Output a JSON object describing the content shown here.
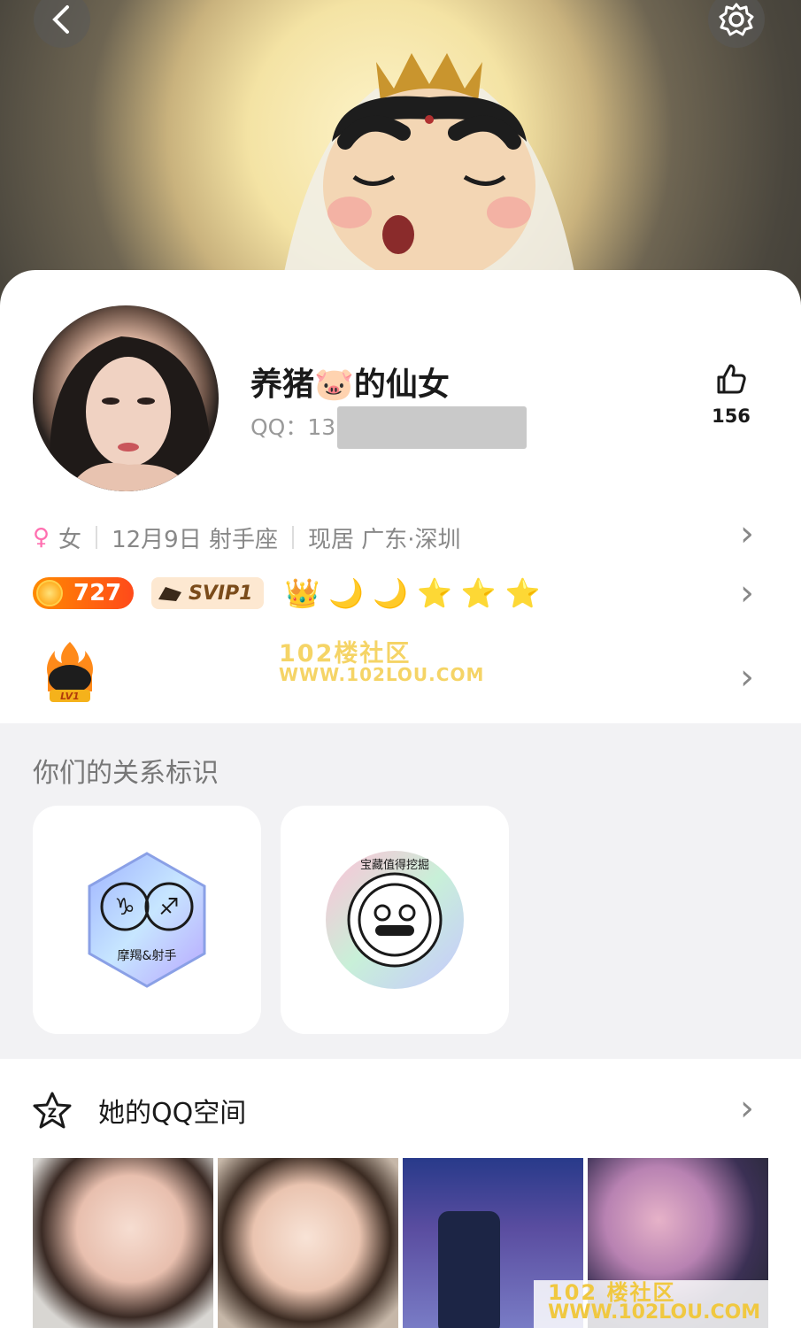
{
  "header": {
    "back_icon": "chevron-left-icon",
    "settings_icon": "gear-icon"
  },
  "profile": {
    "nickname": "养猪🐷的仙女",
    "qq_label": "QQ：13",
    "like_count": "156",
    "gender_symbol": "♀",
    "gender": "女",
    "birthday_sign": "12月9日 射手座",
    "residence": "现居 广东·深圳"
  },
  "badges": {
    "charm_value": "727",
    "svip_label": "SVIP1",
    "level_icons": [
      "👑",
      "🌙",
      "🌙",
      "⭐",
      "⭐",
      "⭐"
    ],
    "lv_label": "LV1"
  },
  "watermark_top": {
    "line1": "102楼社区",
    "line2": "WWW.102LOU.COM"
  },
  "relationship": {
    "title": "你们的关系标识",
    "card1_label": "摩羯&射手",
    "card2_label": "宝藏值得挖掘"
  },
  "space": {
    "title": "她的QQ空间"
  },
  "watermark_bottom": {
    "line1": "102 楼社区",
    "line2": "WWW.102LOU.COM"
  },
  "colors": {
    "female_pink": "#ff6fb0",
    "charm_orange": "#ff6a10",
    "star_gold": "#ffb820"
  }
}
